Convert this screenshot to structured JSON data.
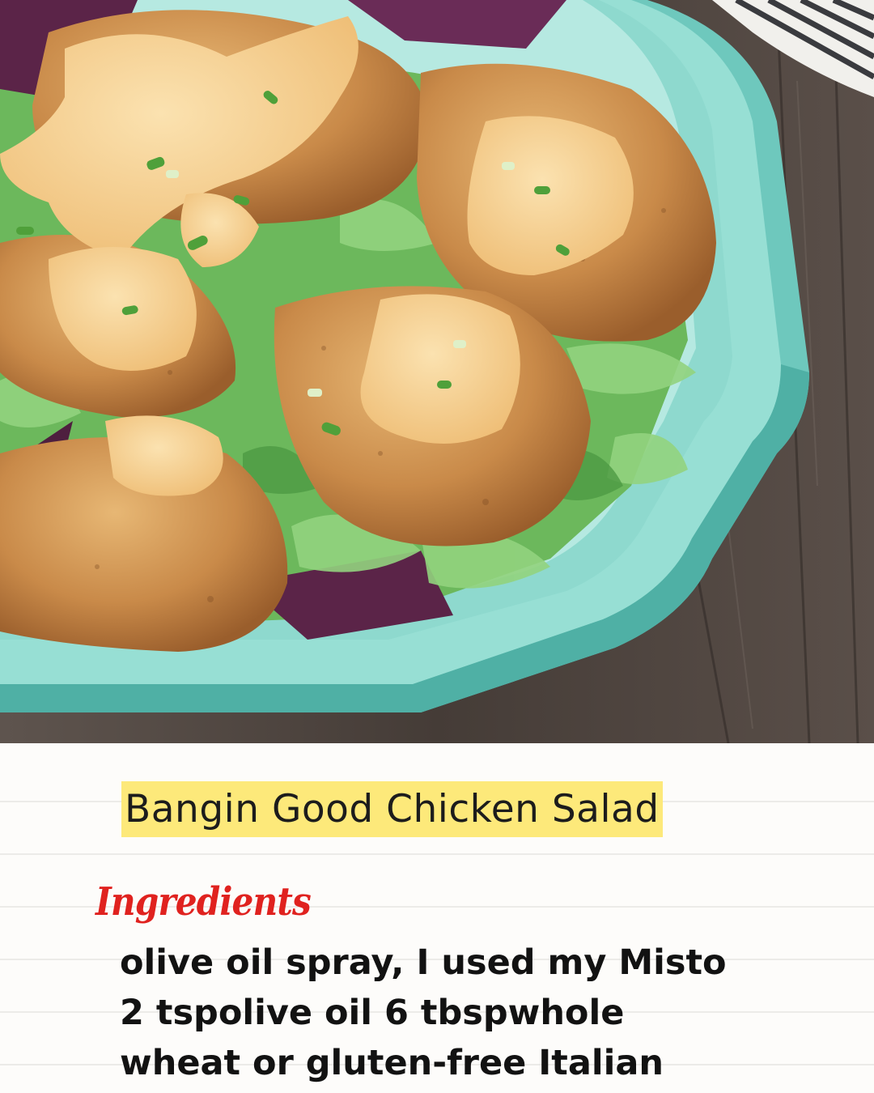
{
  "image": {
    "subject": "chicken-salad-photo",
    "colors": {
      "bowl": "#7fd3c8",
      "table": "#4d4540",
      "sauce": "#f3c781",
      "chicken": "#c98a49",
      "lettuce": "#7cc36a",
      "cabbage": "#5b2448"
    }
  },
  "recipe": {
    "title": "Bangin Good Chicken Salad",
    "ingredients_heading": "Ingredients",
    "ingredient_lines": [
      "olive oil spray, I used my Misto",
      "2 tspolive oil 6 tbspwhole",
      "wheat or gluten-free Italian"
    ]
  },
  "colors": {
    "title_highlight": "#fde97a",
    "heading": "#e0221f",
    "text": "#121212"
  }
}
